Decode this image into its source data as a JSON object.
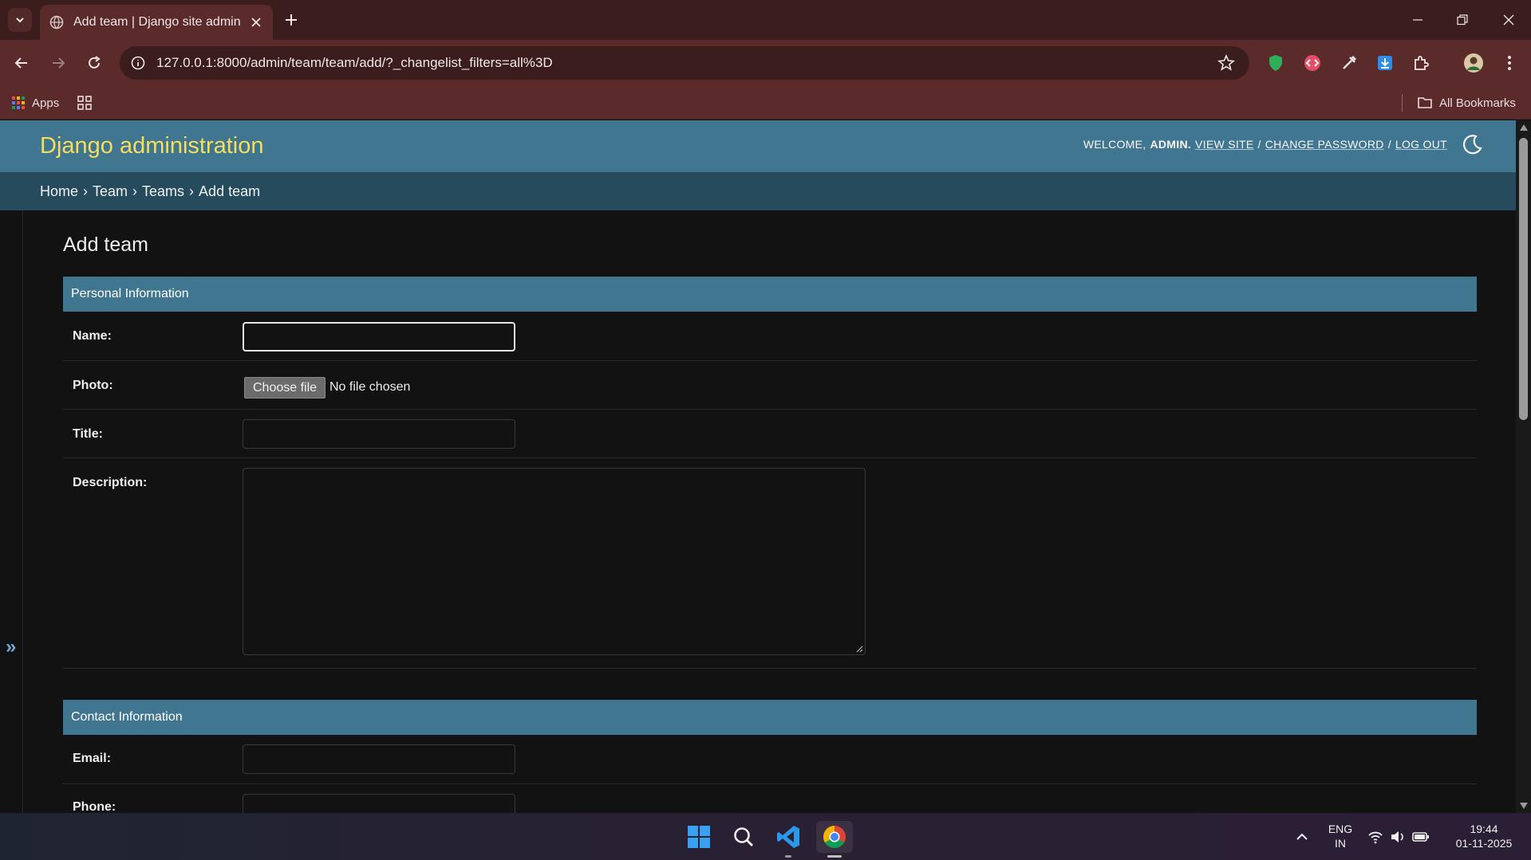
{
  "browser": {
    "tab_title": "Add team | Django site admin",
    "url": "127.0.0.1:8000/admin/team/team/add/?_changelist_filters=all%3D",
    "bookmarks": {
      "apps": "Apps",
      "all_bookmarks": "All Bookmarks"
    }
  },
  "header": {
    "brand": "Django administration",
    "welcome": "WELCOME,",
    "user": "ADMIN.",
    "view_site": "VIEW SITE",
    "change_password": "CHANGE PASSWORD",
    "log_out": "LOG OUT",
    "sep": "/"
  },
  "breadcrumbs": [
    "Home",
    "Team",
    "Teams",
    "Add team"
  ],
  "breadcrumb_sep": "›",
  "sidebar_toggle": "»",
  "page_title": "Add team",
  "fieldsets": {
    "personal": {
      "title": "Personal Information",
      "name_label": "Name:",
      "photo_label": "Photo:",
      "choose_file": "Choose file",
      "no_file": "No file chosen",
      "title_label": "Title:",
      "description_label": "Description:"
    },
    "contact": {
      "title": "Contact Information",
      "email_label": "Email:",
      "phone_label": "Phone:"
    }
  },
  "taskbar": {
    "lang_top": "ENG",
    "lang_bottom": "IN",
    "time": "19:44",
    "date": "01-11-2025"
  },
  "colors": {
    "header": "#417690",
    "breadcrumb": "#264b5d",
    "brand": "#f5dd5d",
    "module": "#417690"
  }
}
